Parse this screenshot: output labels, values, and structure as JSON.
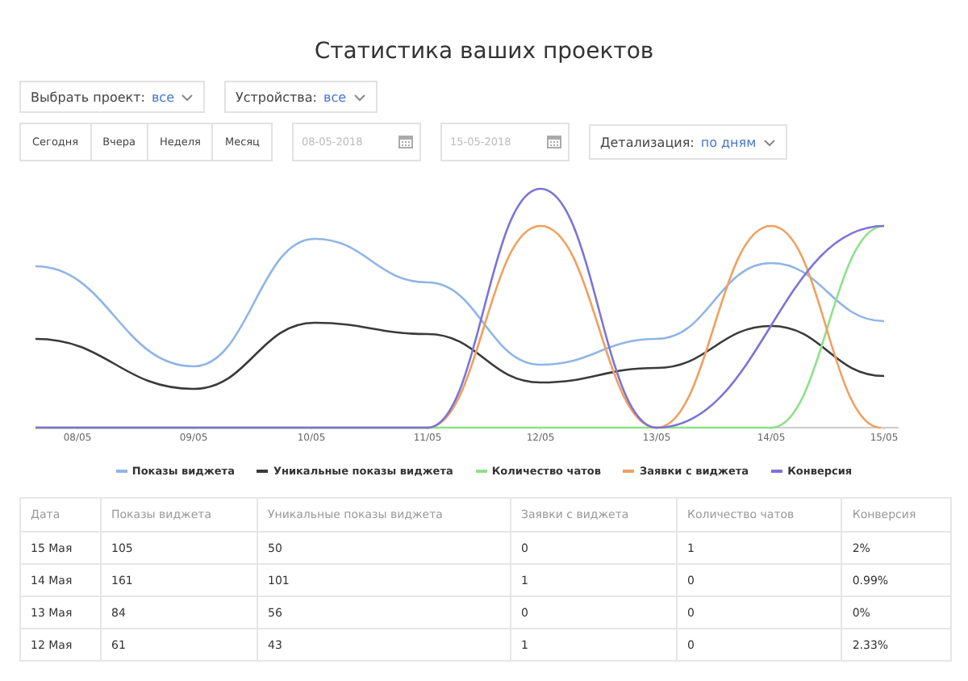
{
  "title": "Статистика ваших проектов",
  "filters": [
    {
      "label": "Выбрать проект:",
      "value": "все"
    },
    {
      "label": "Устройства:",
      "value": "все"
    }
  ],
  "period_buttons": [
    "Сегодня",
    "Вчера",
    "Неделя",
    "Месяц"
  ],
  "date_fields": [
    {
      "placeholder": "08-05-2018"
    },
    {
      "placeholder": "15-05-2018"
    }
  ],
  "detail": {
    "label": "Детализация:",
    "value": "по дням"
  },
  "chart": {
    "x_labels": [
      "08/05",
      "09/05",
      "10/05",
      "11/05",
      "12/05",
      "13/05",
      "14/05",
      "15/05"
    ],
    "legend": [
      {
        "name": "Показы виджета",
        "color": "#8fb5e6"
      },
      {
        "name": "Уникальные показы виджета",
        "color": "#3a3a3a"
      },
      {
        "name": "Количество чатов",
        "color": "#8ee08a"
      },
      {
        "name": "Заявки с виджета",
        "color": "#f0a060"
      },
      {
        "name": "Конверсия",
        "color": "#7a74d8"
      }
    ]
  },
  "table": {
    "columns": [
      "Дата",
      "Показы виджета",
      "Уникальные показы виджета",
      "Заявки с виджета",
      "Количество чатов",
      "Конверсия"
    ],
    "rows": [
      [
        "15 Мая",
        "105",
        "50",
        "0",
        "1",
        "2%"
      ],
      [
        "14 Мая",
        "161",
        "101",
        "1",
        "0",
        "0.99%"
      ],
      [
        "13 Мая",
        "84",
        "56",
        "0",
        "0",
        "0%"
      ],
      [
        "12 Мая",
        "61",
        "43",
        "1",
        "0",
        "2.33%"
      ]
    ]
  }
}
